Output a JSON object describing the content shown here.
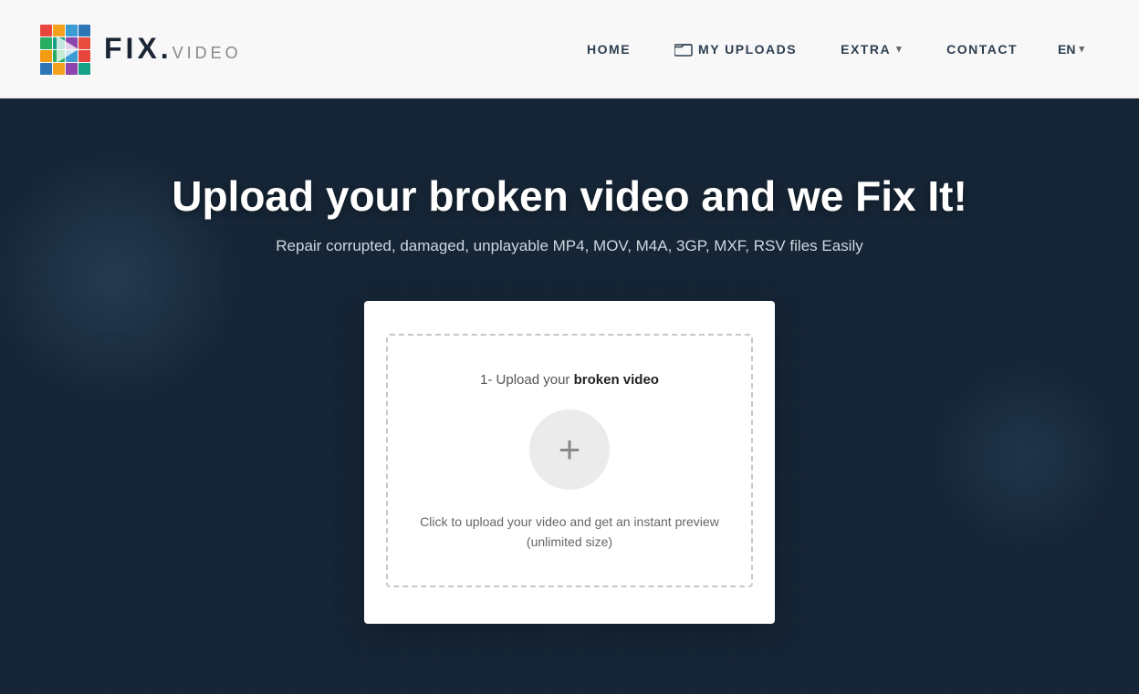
{
  "header": {
    "logo_fix": "FIX.",
    "logo_video": "VIDEO",
    "nav": [
      {
        "id": "home",
        "label": "HOME",
        "has_icon": false,
        "has_chevron": false
      },
      {
        "id": "my-uploads",
        "label": "MY UPLOADS",
        "has_icon": true,
        "has_chevron": false
      },
      {
        "id": "extra",
        "label": "EXTRA",
        "has_icon": false,
        "has_chevron": true
      },
      {
        "id": "contact",
        "label": "CONTACT",
        "has_icon": false,
        "has_chevron": false
      }
    ],
    "lang": "EN",
    "lang_chevron": "▾"
  },
  "hero": {
    "title": "Upload your broken video and we Fix It!",
    "subtitle": "Repair corrupted, damaged, unplayable MP4, MOV, M4A, 3GP, MXF, RSV files Easily"
  },
  "upload_card": {
    "step_label_prefix": "1- Upload your ",
    "step_label_bold": "broken video",
    "plus_icon": "+",
    "hint_line1": "Click to upload your video and get an instant preview",
    "hint_line2": "(unlimited size)"
  }
}
